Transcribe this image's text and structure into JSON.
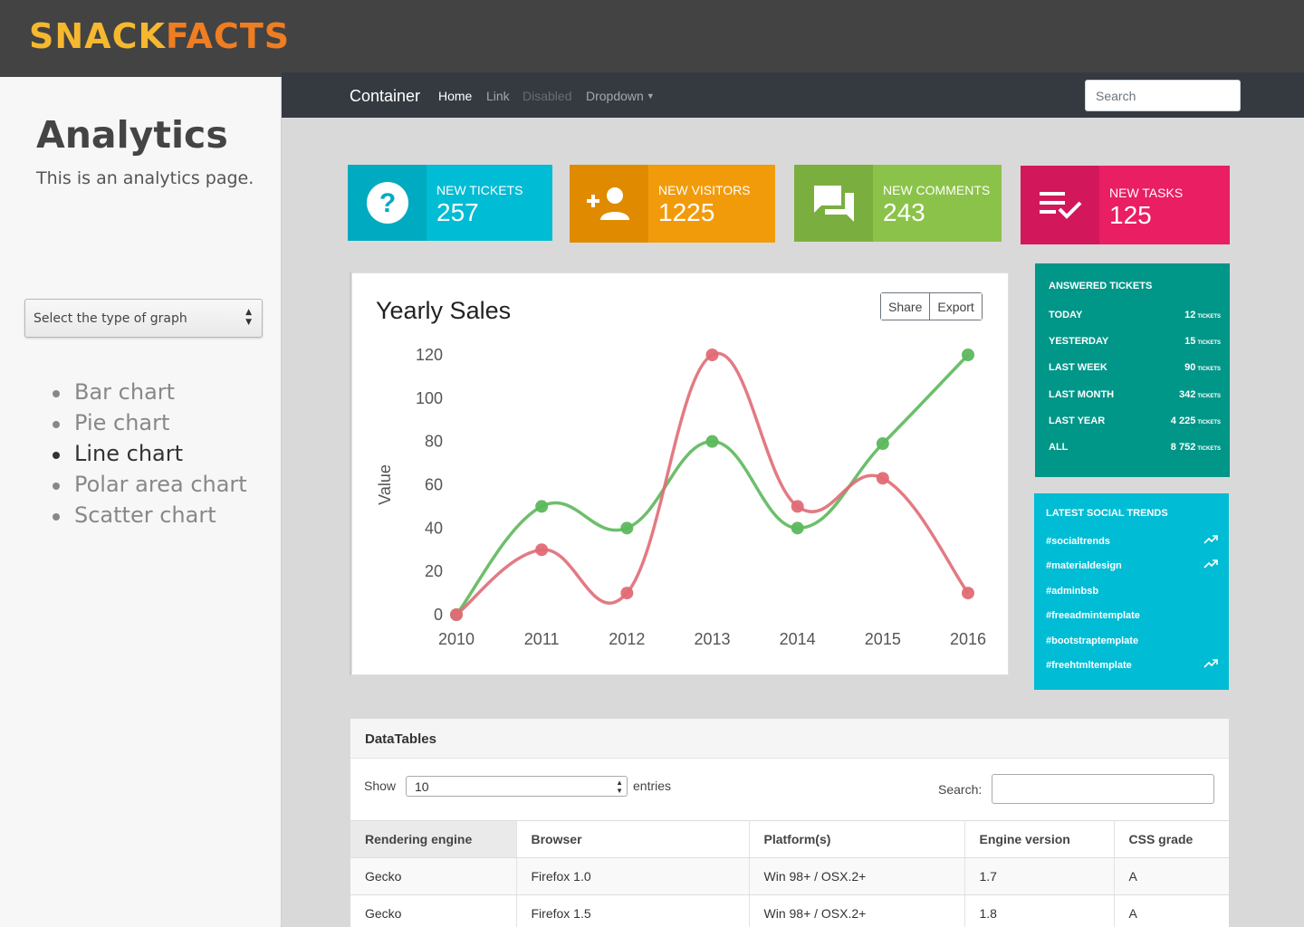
{
  "logo": {
    "part1": "SNACK",
    "part2": "FACTS"
  },
  "sidebar": {
    "title": "Analytics",
    "subtitle": "This is an analytics page.",
    "select_placeholder": "Select the type of graph",
    "chart_types": [
      {
        "label": "Bar chart",
        "active": false
      },
      {
        "label": "Pie chart",
        "active": false
      },
      {
        "label": "Line chart",
        "active": true
      },
      {
        "label": "Polar area chart",
        "active": false
      },
      {
        "label": "Scatter chart",
        "active": false
      }
    ]
  },
  "navbar": {
    "brand": "Container",
    "links": [
      "Home",
      "Link",
      "Disabled",
      "Dropdown"
    ],
    "search_placeholder": "Search"
  },
  "stats": [
    {
      "label": "NEW TICKETS",
      "value": "257",
      "icon": "help-circle-icon",
      "color": "#00bcd4",
      "icon_bg": "#00aac0"
    },
    {
      "label": "NEW VISITORS",
      "value": "1225",
      "icon": "person-add-icon",
      "color": "#f29b0a",
      "icon_bg": "#e08a00"
    },
    {
      "label": "NEW COMMENTS",
      "value": "243",
      "icon": "forum-icon",
      "color": "#8bc34a",
      "icon_bg": "#7aaf3f"
    },
    {
      "label": "NEW TASKS",
      "value": "125",
      "icon": "playlist-check-icon",
      "color": "#e91e63",
      "icon_bg": "#d2175a"
    }
  ],
  "chart_panel": {
    "title": "Yearly Sales",
    "share_label": "Share",
    "export_label": "Export"
  },
  "chart_data": {
    "type": "line",
    "title": "Yearly Sales",
    "x": [
      "2010",
      "2011",
      "2012",
      "2013",
      "2014",
      "2015",
      "2016"
    ],
    "xlabel": "",
    "ylabel": "Value",
    "ylim": [
      0,
      120
    ],
    "yticks": [
      0,
      20,
      40,
      60,
      80,
      100,
      120
    ],
    "grid": false,
    "series": [
      {
        "color": "#5cb85c",
        "values": [
          0,
          50,
          40,
          80,
          40,
          79,
          120
        ]
      },
      {
        "color": "#e06c75",
        "values": [
          0,
          30,
          10,
          120,
          50,
          63,
          10
        ]
      }
    ]
  },
  "answered_tickets": {
    "title": "ANSWERED TICKETS",
    "unit": "TICKETS",
    "rows": [
      {
        "label": "TODAY",
        "value": "12"
      },
      {
        "label": "YESTERDAY",
        "value": "15"
      },
      {
        "label": "LAST WEEK",
        "value": "90"
      },
      {
        "label": "LAST MONTH",
        "value": "342"
      },
      {
        "label": "LAST YEAR",
        "value": "4 225"
      },
      {
        "label": "ALL",
        "value": "8 752"
      }
    ]
  },
  "social_trends": {
    "title": "LATEST SOCIAL TRENDS",
    "rows": [
      {
        "tag": "#socialtrends",
        "trending": true
      },
      {
        "tag": "#materialdesign",
        "trending": true
      },
      {
        "tag": "#adminbsb",
        "trending": false
      },
      {
        "tag": "#freeadmintemplate",
        "trending": false
      },
      {
        "tag": "#bootstraptemplate",
        "trending": false
      },
      {
        "tag": "#freehtmltemplate",
        "trending": true
      }
    ]
  },
  "datatable": {
    "title": "DataTables",
    "show_label": "Show",
    "page_length": "10",
    "entries_label": "entries",
    "search_label": "Search:",
    "columns": [
      "Rendering engine",
      "Browser",
      "Platform(s)",
      "Engine version",
      "CSS grade"
    ],
    "rows": [
      [
        "Gecko",
        "Firefox 1.0",
        "Win 98+ / OSX.2+",
        "1.7",
        "A"
      ],
      [
        "Gecko",
        "Firefox 1.5",
        "Win 98+ / OSX.2+",
        "1.8",
        "A"
      ]
    ]
  }
}
